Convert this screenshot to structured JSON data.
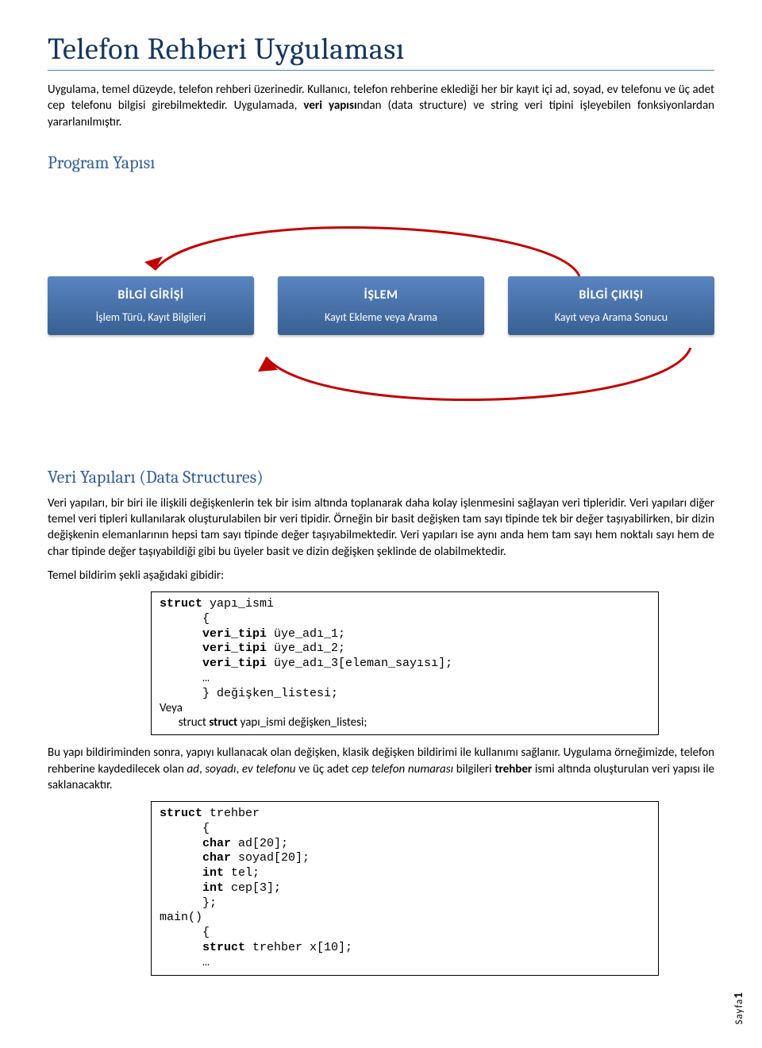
{
  "title": "Telefon Rehberi Uygulaması",
  "intro": "Uygulama, temel düzeyde, telefon rehberi üzerinedir. Kullanıcı, telefon rehberine eklediği her bir kayıt içi ad, soyad, ev telefonu ve üç adet cep telefonu bilgisi girebilmektedir. Uygulamada, ",
  "intro_bold": "veri yapısı",
  "intro_tail": "ndan (data structure) ve string veri tipini işleyebilen fonksiyonlardan yararlanılmıştır.",
  "sections": {
    "program_yapisi": "Program Yapısı",
    "veri_yapilari": "Veri Yapıları (Data Structures)"
  },
  "diagram": {
    "box1": {
      "title": "BİLGİ GİRİŞİ",
      "sub": "İşlem Türü, Kayıt Bilgileri"
    },
    "box2": {
      "title": "İŞLEM",
      "sub": "Kayıt Ekleme veya Arama"
    },
    "box3": {
      "title": "BİLGİ ÇIKIŞI",
      "sub": "Kayıt veya Arama Sonucu"
    }
  },
  "vy_paragraph": "Veri yapıları, bir biri ile ilişkili değişkenlerin tek bir isim altında toplanarak daha kolay işlenmesini sağlayan veri tipleridir. Veri yapıları diğer temel veri tipleri kullanılarak oluşturulabilen bir veri tipidir. Örneğin bir basit değişken tam sayı tipinde tek bir değer taşıyabilirken, bir dizin değişkenin elemanlarının hepsi tam sayı tipinde değer taşıyabilmektedir. Veri yapıları ise aynı anda hem tam sayı hem noktalı sayı hem de char tipinde değer taşıyabildiği gibi bu üyeler basit ve dizin değişken şeklinde de olabilmektedir.",
  "temel_bildirim_label": "Temel bildirim şekli aşağıdaki gibidir:",
  "code1": {
    "l1": "struct yapı_ismi",
    "l2": "      {",
    "l3a": "      veri_tipi ",
    "l3b": "üye_adı_1;",
    "l4a": "      veri_tipi ",
    "l4b": "üye_adı_2;",
    "l5a": "      veri_tipi ",
    "l5b": "üye_adı_3[eleman_sayısı];",
    "l6": "      …",
    "l7": "      } değişken_listesi;",
    "veya": "Veya",
    "alt_prefix": "       struct ",
    "alt_tail": "yapı_ismi  değişken_listesi;"
  },
  "after_code1_a": "Bu yapı bildiriminden sonra, yapıyı kullanacak olan değişken, klasik değişken bildirimi ile kullanımı sağlanır. Uygulama örneğimizde, telefon rehberine kaydedilecek olan ",
  "after_code1_em": [
    "ad",
    "soyadı",
    "ev telefonu",
    "cep telefon numarası"
  ],
  "after_code1_mid1": ", ",
  "after_code1_mid2": " ve üç adet ",
  "after_code1_mid3": " bilgileri ",
  "after_code1_bold": "trehber",
  "after_code1_tail": " ismi altında oluşturulan veri yapısı ile saklanacaktır.",
  "code2": {
    "l1a": "struct ",
    "l1b": "trehber",
    "l2": "      {",
    "l3a": "      char ",
    "l3b": "ad[20];",
    "l4a": "      char ",
    "l4b": "soyad[20];",
    "l5a": "      int ",
    "l5b": "tel;",
    "l6a": "      int ",
    "l6b": "cep[3];",
    "l7": "      };",
    "l8": "main()",
    "l9": "      {",
    "l10a": "      struct ",
    "l10b": "trehber x[10];",
    "l11": "      …"
  },
  "page": {
    "label": "Sayfa",
    "num": "1"
  }
}
